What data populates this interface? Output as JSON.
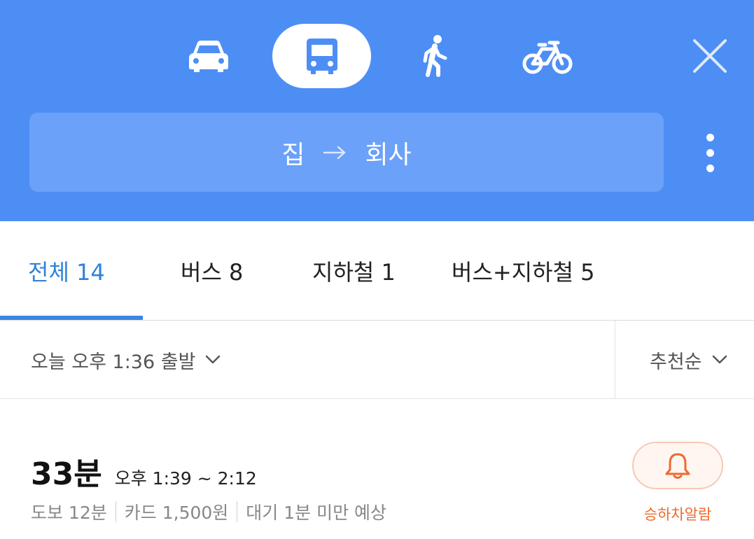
{
  "header": {
    "modes": [
      {
        "name": "car",
        "icon": "car-icon",
        "active": false
      },
      {
        "name": "bus",
        "icon": "bus-icon",
        "active": true
      },
      {
        "name": "walk",
        "icon": "walk-icon",
        "active": false
      },
      {
        "name": "bike",
        "icon": "bike-icon",
        "active": false
      }
    ],
    "close_icon": "close-icon",
    "route": {
      "from": "집",
      "to": "회사",
      "arrow_icon": "arrow-right-icon"
    },
    "more_icon": "more-vertical-icon",
    "colors": {
      "background": "#4d8ef5",
      "route_box": "#6ba1f8"
    }
  },
  "tabs": [
    {
      "label": "전체 14",
      "active": true
    },
    {
      "label": "버스 8",
      "active": false
    },
    {
      "label": "지하철 1",
      "active": false
    },
    {
      "label": "버스+지하철 5",
      "active": false
    }
  ],
  "filter": {
    "departure": "오늘 오후 1:36 출발",
    "sort": "추천순",
    "chevron_icon": "chevron-down-icon"
  },
  "result": {
    "duration": "33분",
    "time_range": "오후 1:39 ~ 2:12",
    "details": [
      "도보 12분",
      "카드 1,500원",
      "대기 1분 미만 예상"
    ],
    "alarm_label": "승하차알람",
    "alarm_icon": "bell-icon"
  },
  "colors": {
    "accent": "#3083d8",
    "alarm": "#ee6a2e"
  }
}
